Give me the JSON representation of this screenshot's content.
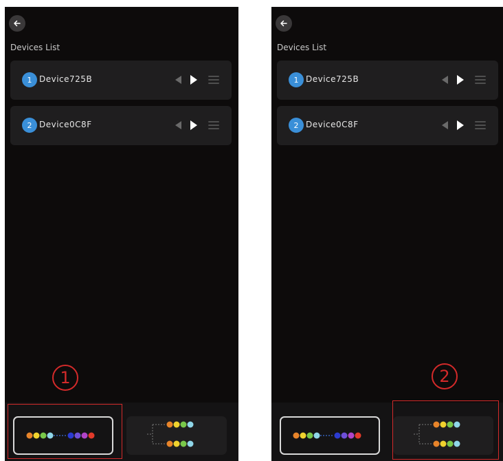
{
  "screens": [
    {
      "list_title": "Devices List",
      "devices": [
        {
          "index": "1",
          "name": "Device725B"
        },
        {
          "index": "2",
          "name": "Device0C8F"
        }
      ]
    },
    {
      "list_title": "Devices List",
      "devices": [
        {
          "index": "1",
          "name": "Device725B"
        },
        {
          "index": "2",
          "name": "Device0C8F"
        }
      ]
    }
  ],
  "annotations": [
    "1",
    "2"
  ],
  "colors": {
    "background": "#0d0b0b",
    "row": "#1f1e1f",
    "badge": "#3a8fd8",
    "annotation": "#d42a2a",
    "serial_dots": [
      "#e8842a",
      "#f0d22e",
      "#79c84a",
      "#8fd6e8",
      "#2b3bd0",
      "#6e4fd8",
      "#b044c8",
      "#e23a2a"
    ],
    "parallel_dots": [
      "#e8842a",
      "#f0d22e",
      "#79c84a",
      "#8fd6e8"
    ]
  },
  "icons": {
    "back": "arrow-left-icon",
    "prev": "triangle-left-icon",
    "next": "triangle-right-icon",
    "menu": "drag-handle-icon"
  }
}
